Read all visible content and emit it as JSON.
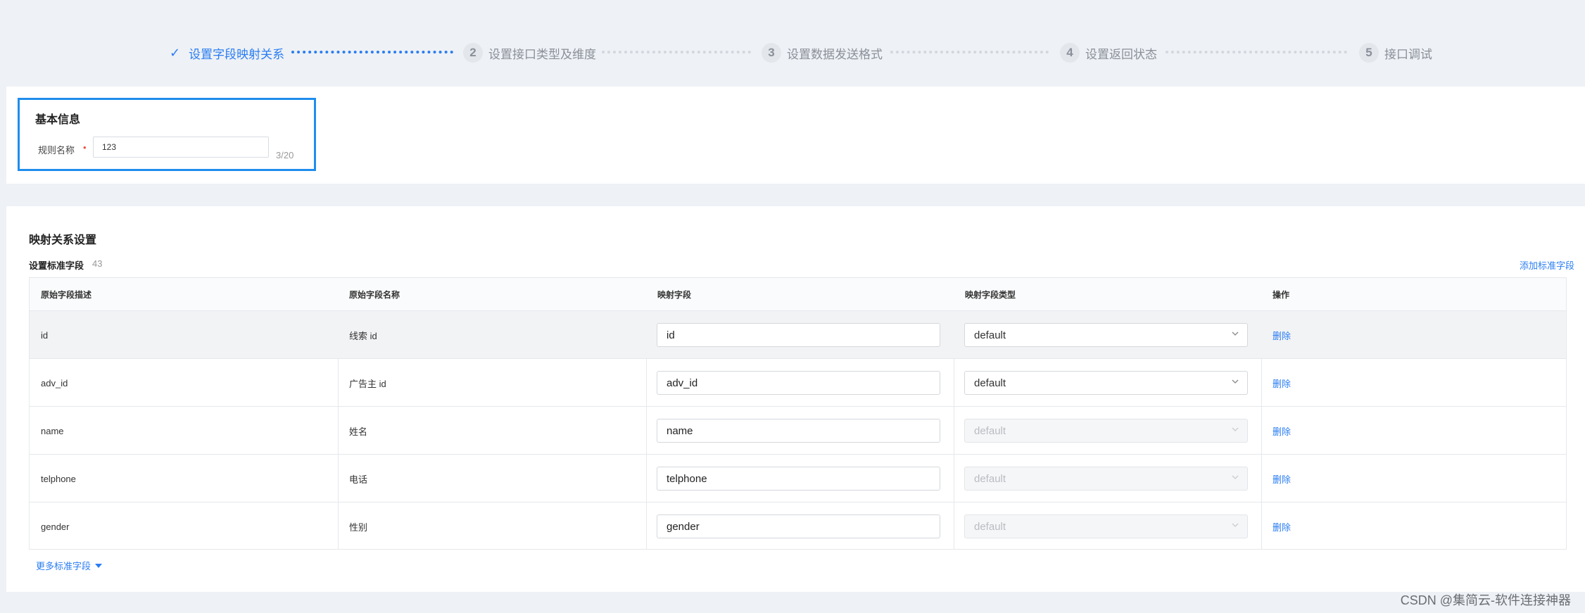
{
  "steps": [
    {
      "label": "设置字段映射关系",
      "number": "",
      "state": "done"
    },
    {
      "label": "设置接口类型及维度",
      "number": "2",
      "state": "todo"
    },
    {
      "label": "设置数据发送格式",
      "number": "3",
      "state": "todo"
    },
    {
      "label": "设置返回状态",
      "number": "4",
      "state": "todo"
    },
    {
      "label": "接口调试",
      "number": "5",
      "state": "todo"
    }
  ],
  "basic": {
    "title": "基本信息",
    "name_label": "规则名称",
    "required_mark": "•",
    "name_value": "123",
    "count": "3/20"
  },
  "mapping": {
    "title": "映射关系设置",
    "subtitle": "设置标准字段",
    "field_count": "43",
    "add_link": "添加标准字段",
    "columns": [
      "原始字段描述",
      "原始字段名称",
      "映射字段",
      "映射字段类型",
      "操作"
    ],
    "rows": [
      {
        "desc": "id",
        "name": "线索 id",
        "mapped": "id",
        "type": "default",
        "type_enabled": true,
        "action": "删除"
      },
      {
        "desc": "adv_id",
        "name": "广告主 id",
        "mapped": "adv_id",
        "type": "default",
        "type_enabled": true,
        "action": "删除"
      },
      {
        "desc": "name",
        "name": "姓名",
        "mapped": "name",
        "type": "default",
        "type_enabled": false,
        "action": "删除"
      },
      {
        "desc": "telphone",
        "name": "电话",
        "mapped": "telphone",
        "type": "default",
        "type_enabled": false,
        "action": "删除"
      },
      {
        "desc": "gender",
        "name": "性别",
        "mapped": "gender",
        "type": "default",
        "type_enabled": false,
        "action": "删除"
      }
    ],
    "more_link": "更多标准字段"
  },
  "watermark": "CSDN @集简云-软件连接神器",
  "colors": {
    "accent": "#2a7df3",
    "focus_border": "#1f8ded",
    "required": "#e6543f"
  }
}
